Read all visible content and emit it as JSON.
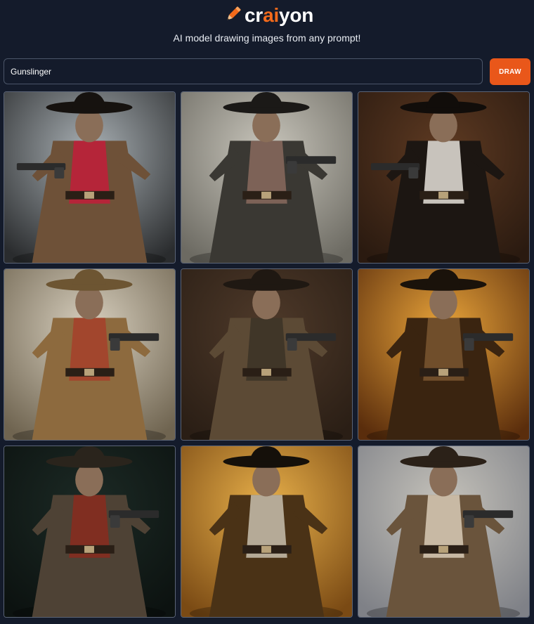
{
  "app": {
    "name_prefix": "cr",
    "name_highlight": "ai",
    "name_suffix": "yon",
    "tagline": "AI model drawing images from any prompt!",
    "logo_icon": "pencil-icon"
  },
  "prompt": {
    "value": "Gunslinger",
    "draw_label": "DRAW"
  },
  "colors": {
    "background": "#141b2b",
    "accent": "#e9571a",
    "brand_highlight": "#f26a1b",
    "input_border": "#4b5568"
  },
  "results": [
    {
      "bg": [
        "#a9b0b4",
        "#2a2c2e"
      ],
      "coat": "#6e5138",
      "hat": "#16120f",
      "scarf": "#c21d3a",
      "gun": "left"
    },
    {
      "bg": [
        "#c9c6bc",
        "#6c6a62"
      ],
      "coat": "#3a3833",
      "hat": "#1b1917",
      "scarf": "#8a6a5e",
      "gun": "right"
    },
    {
      "bg": [
        "#5e3a22",
        "#2a1a10"
      ],
      "coat": "#1c1612",
      "hat": "#110d0a",
      "scarf": "#e6e2da",
      "gun": "left"
    },
    {
      "bg": [
        "#d8d0bf",
        "#6f6450"
      ],
      "coat": "#8d6a3e",
      "hat": "#6d5532",
      "scarf": "#a6402a",
      "gun": "right"
    },
    {
      "bg": [
        "#4f3a2a",
        "#2a1e15"
      ],
      "coat": "#5c4a35",
      "hat": "#1f1812",
      "scarf": "#3b3326",
      "gun": "right"
    },
    {
      "bg": [
        "#e9a43a",
        "#5a2d0c"
      ],
      "coat": "#3a2410",
      "hat": "#1a120a",
      "scarf": "#7a5630",
      "gun": "right"
    },
    {
      "bg": [
        "#1c2a25",
        "#0c1210"
      ],
      "coat": "#4e4235",
      "hat": "#2a241c",
      "scarf": "#8a2a1d",
      "gun": "right"
    },
    {
      "bg": [
        "#e8b04a",
        "#7a4a14"
      ],
      "coat": "#4a3216",
      "hat": "#15100a",
      "scarf": "#c8c0ae",
      "gun": "none"
    },
    {
      "bg": [
        "#c6c3bb",
        "#7f8187"
      ],
      "coat": "#6a543c",
      "hat": "#2b2118",
      "scarf": "#d8cbb6",
      "gun": "right"
    }
  ]
}
